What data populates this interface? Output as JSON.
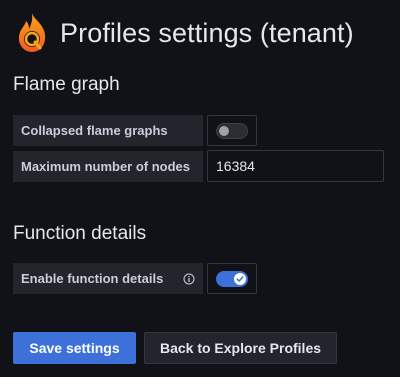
{
  "header": {
    "title": "Profiles settings (tenant)",
    "logo_icon": "pyroscope-flame-logo"
  },
  "flame_graph": {
    "section_title": "Flame graph",
    "collapsed": {
      "label": "Collapsed flame graphs",
      "enabled": false
    },
    "max_nodes": {
      "label": "Maximum number of nodes",
      "value": "16384"
    }
  },
  "function_details": {
    "section_title": "Function details",
    "enable": {
      "label": "Enable function details",
      "enabled": true,
      "info_icon": "info-circle-icon"
    }
  },
  "actions": {
    "save_label": "Save settings",
    "back_label": "Back to Explore Profiles"
  },
  "colors": {
    "accent": "#3d71d9",
    "background": "#111217",
    "label_bg": "#22252b",
    "logo_orange": "#f46f1e"
  }
}
